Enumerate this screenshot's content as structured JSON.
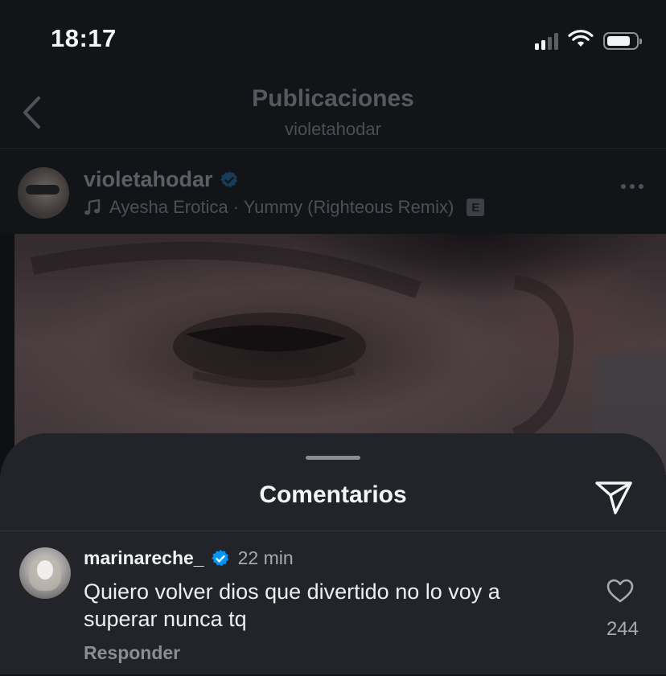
{
  "status_bar": {
    "time": "18:17",
    "signal_bars": 4,
    "signal_active": 2
  },
  "nav": {
    "title": "Publicaciones",
    "subtitle": "violetahodar"
  },
  "post": {
    "username": "violetahodar",
    "verified": true,
    "music": "Ayesha Erotica · Yummy (Righteous Remix)",
    "explicit_badge": "E"
  },
  "comments_sheet": {
    "title": "Comentarios",
    "comments": [
      {
        "username": "marinareche_",
        "verified": true,
        "time": "22 min",
        "text": "Quiero volver dios que divertido no lo voy a superar nunca tq",
        "likes": "244",
        "reply_label": "Responder"
      }
    ]
  },
  "colors": {
    "verified_blue": "#0095f6",
    "sheet_bg": "#22242a",
    "page_bg": "#111419"
  },
  "icons": [
    "back-chevron-icon",
    "wifi-icon",
    "battery-icon",
    "signal-icon",
    "verified-badge-icon",
    "music-note-icon",
    "more-icon",
    "share-paper-plane-icon",
    "heart-icon"
  ]
}
